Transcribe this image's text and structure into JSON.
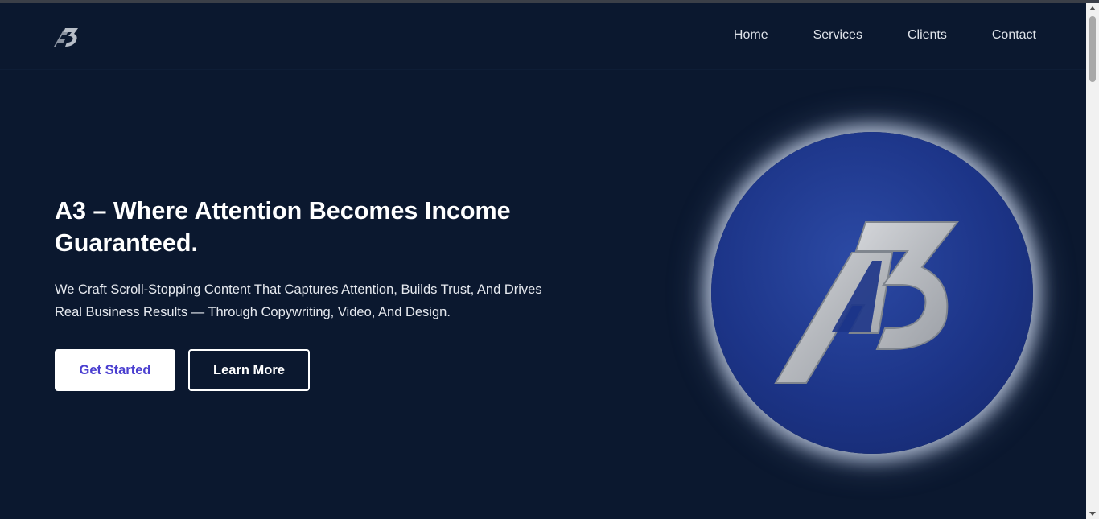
{
  "header": {
    "logo_icon": "a3-logo-icon",
    "nav": [
      {
        "label": "Home"
      },
      {
        "label": "Services"
      },
      {
        "label": "Clients"
      },
      {
        "label": "Contact"
      }
    ]
  },
  "hero": {
    "title": "A3 – Where Attention Becomes Income Guaranteed.",
    "description": "We Craft Scroll-Stopping Content That Captures Attention, Builds Trust, And Drives Real Business Results — Through Copywriting, Video, And Design.",
    "primary_button": "Get Started",
    "secondary_button": "Learn More",
    "emblem_icon": "a3-emblem-icon"
  },
  "colors": {
    "background": "#0b182f",
    "primary_button_text": "#4b3fd0",
    "emblem_blue": "#1c3487"
  }
}
